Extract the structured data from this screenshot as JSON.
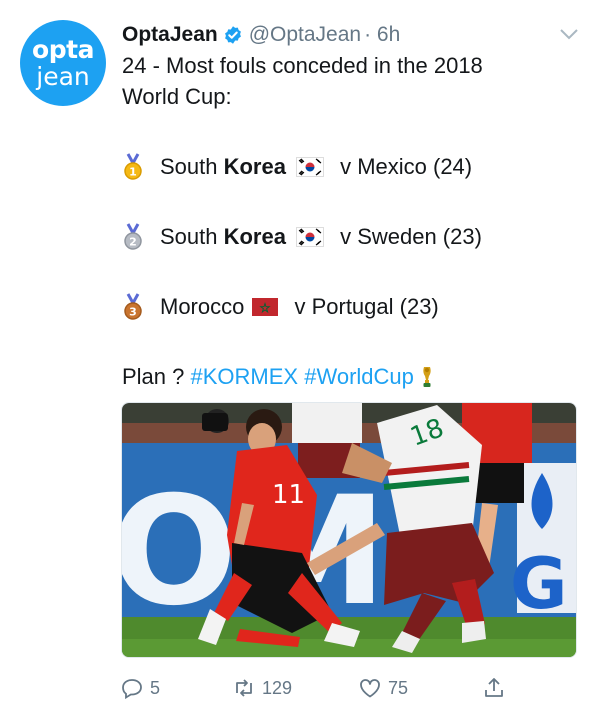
{
  "user": {
    "avatar_line1": "opta",
    "avatar_line2": "jean",
    "name": "OptaJean",
    "handle": "@OptaJean",
    "time": "· 6h"
  },
  "tweet": {
    "line1": "24 - Most fouls conceded in the 2018",
    "line2": "World Cup:",
    "items": [
      {
        "medal": "1",
        "pre": "South ",
        "bold": "Korea",
        "post": " v Mexico (24)",
        "flag": "south-korea-flag"
      },
      {
        "medal": "2",
        "pre": "South ",
        "bold": "Korea",
        "post": " v Sweden (23)",
        "flag": "south-korea-flag"
      },
      {
        "medal": "3",
        "pre": "Morocco",
        "bold": "",
        "post": " v Portugal (23)",
        "flag": "morocco-flag"
      }
    ],
    "closing": "Plan ?",
    "hashtag1": "#KORMEX",
    "hashtag2": "#WorldCup"
  },
  "actions": {
    "replies": "5",
    "retweets": "129",
    "likes": "75"
  },
  "colors": {
    "accent": "#1da1f2",
    "text": "#14171a",
    "muted": "#657786"
  },
  "icons": [
    "verified-badge-icon",
    "chevron-down-icon",
    "gold-medal-icon",
    "silver-medal-icon",
    "bronze-medal-icon",
    "trophy-icon",
    "reply-icon",
    "retweet-icon",
    "like-icon",
    "share-icon"
  ]
}
